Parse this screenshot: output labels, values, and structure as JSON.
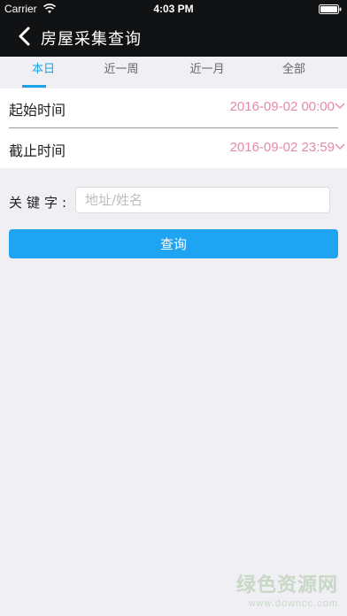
{
  "status_bar": {
    "carrier": "Carrier",
    "time": "4:03 PM",
    "icons": [
      "wifi-icon",
      "battery-icon"
    ]
  },
  "nav": {
    "title": "房屋采集查询",
    "back_icon": "chevron-left-icon"
  },
  "tabs": [
    {
      "label": "本日",
      "active": true
    },
    {
      "label": "近一周",
      "active": false
    },
    {
      "label": "近一月",
      "active": false
    },
    {
      "label": "全部",
      "active": false
    }
  ],
  "form": {
    "start": {
      "label": "起始时间",
      "value": "2016-09-02 00:00"
    },
    "end": {
      "label": "截止时间",
      "value": "2016-09-02 23:59"
    }
  },
  "keyword": {
    "label": "关键字:",
    "placeholder": "地址/姓名",
    "value": ""
  },
  "query_button": "查询",
  "watermark": {
    "text": "绿色资源网",
    "url": "www.downcc.com"
  },
  "colors": {
    "accent": "#1aa3e8",
    "button": "#1ea4f0",
    "date_value": "#e58aa6",
    "nav_bar": "#111214",
    "background": "#efeff4"
  }
}
